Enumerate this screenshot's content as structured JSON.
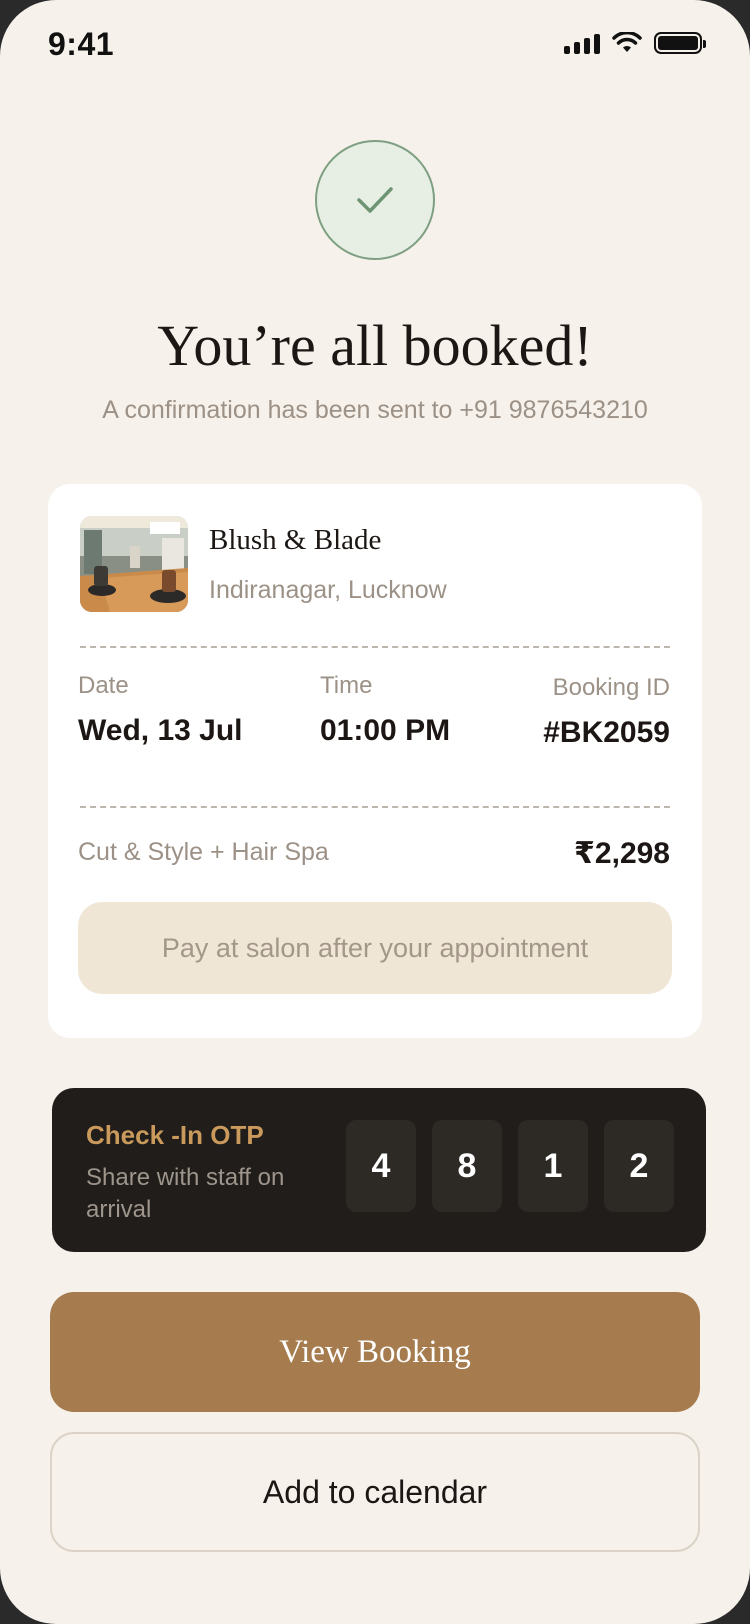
{
  "status_bar": {
    "time": "9:41"
  },
  "header": {
    "title": "You’re all booked!",
    "subtitle": "A confirmation has been sent to +91 9876543210"
  },
  "booking": {
    "salon_name": "Blush & Blade",
    "salon_location": "Indiranagar, Lucknow",
    "date_label": "Date",
    "date_value": "Wed, 13 Jul",
    "time_label": "Time",
    "time_value": "01:00 PM",
    "id_label": "Booking ID",
    "id_value": "#BK2059",
    "service": "Cut & Style + Hair Spa",
    "price": "₹2,298",
    "pay_note": "Pay at salon after your appointment"
  },
  "otp": {
    "title": "Check -In OTP",
    "subtitle": "Share with staff on arrival",
    "digits": [
      "4",
      "8",
      "1",
      "2"
    ]
  },
  "actions": {
    "view_booking": "View Booking",
    "add_calendar": "Add to calendar"
  },
  "colors": {
    "background": "#f6f1ea",
    "accent": "#a67c4f",
    "success": "#7e9f82",
    "dark_card": "#201d1a",
    "otp_title": "#c99a5c"
  },
  "icons": [
    "signal-icon",
    "wifi-icon",
    "battery-icon",
    "checkmark-icon"
  ]
}
